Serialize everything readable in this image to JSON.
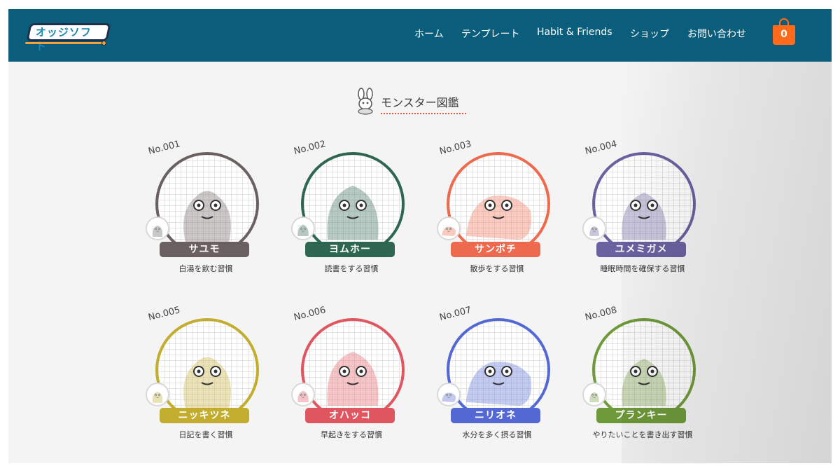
{
  "header": {
    "logo_text": "オッジソフト",
    "nav": [
      {
        "label": "ホーム"
      },
      {
        "label": "テンプレート"
      },
      {
        "label": "Habit & Friends"
      },
      {
        "label": "ショップ"
      },
      {
        "label": "お問い合わせ"
      }
    ],
    "cart_count": "0",
    "colors": {
      "bar": "#0b5d7c",
      "cart": "#ff6b1a"
    }
  },
  "page": {
    "title": "モンスター図鑑"
  },
  "monsters": [
    {
      "no": "No.001",
      "name": "サユモ",
      "habit": "白湯を飲む習慣",
      "color": "#6b6060"
    },
    {
      "no": "No.002",
      "name": "ヨムホー",
      "habit": "読書をする習慣",
      "color": "#2e6650"
    },
    {
      "no": "No.003",
      "name": "サンポチ",
      "habit": "散歩をする習慣",
      "color": "#ee6a4e"
    },
    {
      "no": "No.004",
      "name": "ユメミガメ",
      "habit": "睡眠時間を確保する習慣",
      "color": "#6a62a0"
    },
    {
      "no": "No.005",
      "name": "ニッキツネ",
      "habit": "日記を書く習慣",
      "color": "#c2ad2e"
    },
    {
      "no": "No.006",
      "name": "オハッコ",
      "habit": "早起きをする習慣",
      "color": "#e05660"
    },
    {
      "no": "No.007",
      "name": "ニリオネ",
      "habit": "水分を多く摂る習慣",
      "color": "#5468d4"
    },
    {
      "no": "No.008",
      "name": "プランキー",
      "habit": "やりたいことを書き出す習慣",
      "color": "#6f9a3a"
    }
  ]
}
